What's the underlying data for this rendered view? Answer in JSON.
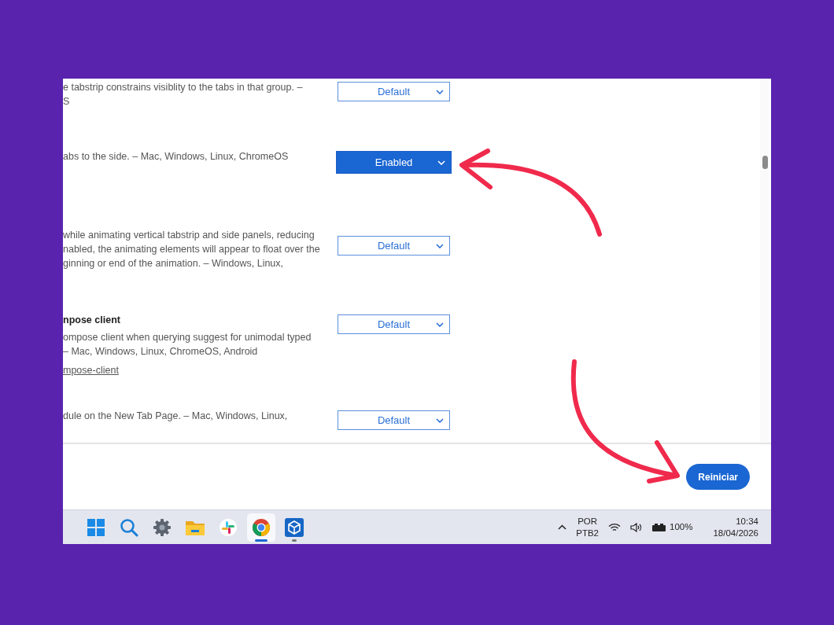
{
  "flags": [
    {
      "lines": [
        "e tabstrip constrains visiblity to the tabs in that group. –",
        "S"
      ],
      "dropdown": {
        "value": "Default",
        "highlighted": false
      }
    },
    {
      "lines": [
        "abs to the side. – Mac, Windows, Linux, ChromeOS"
      ],
      "dropdown": {
        "value": "Enabled",
        "highlighted": true
      }
    },
    {
      "lines": [
        "while animating vertical tabstrip and side panels, reducing",
        "nabled, the animating elements will appear to float over the",
        "ginning or end of the animation. – Windows, Linux,"
      ],
      "dropdown": {
        "value": "Default",
        "highlighted": false
      }
    },
    {
      "title": "npose client",
      "lines": [
        "ompose client when querying suggest for unimodal typed",
        "– Mac, Windows, Linux, ChromeOS, Android"
      ],
      "link": "mpose-client",
      "dropdown": {
        "value": "Default",
        "highlighted": false
      }
    },
    {
      "lines": [
        "dule on the New Tab Page. – Mac, Windows, Linux,"
      ],
      "dropdown": {
        "value": "Default",
        "highlighted": false
      }
    }
  ],
  "restart_button": "Reiniciar",
  "taskbar": {
    "apps": [
      {
        "kind": "start",
        "selected": false,
        "running": false
      },
      {
        "kind": "search",
        "selected": false,
        "running": false
      },
      {
        "kind": "settings",
        "selected": false,
        "running": false
      },
      {
        "kind": "folder",
        "selected": false,
        "running": false
      },
      {
        "kind": "pinwheel",
        "selected": false,
        "running": false
      },
      {
        "kind": "browser",
        "selected": true,
        "running": true
      },
      {
        "kind": "cube",
        "selected": false,
        "running": true
      }
    ],
    "language": [
      "POR",
      "PTB2"
    ],
    "battery": "100%",
    "time": "10:34",
    "date": "18/04/2026"
  }
}
